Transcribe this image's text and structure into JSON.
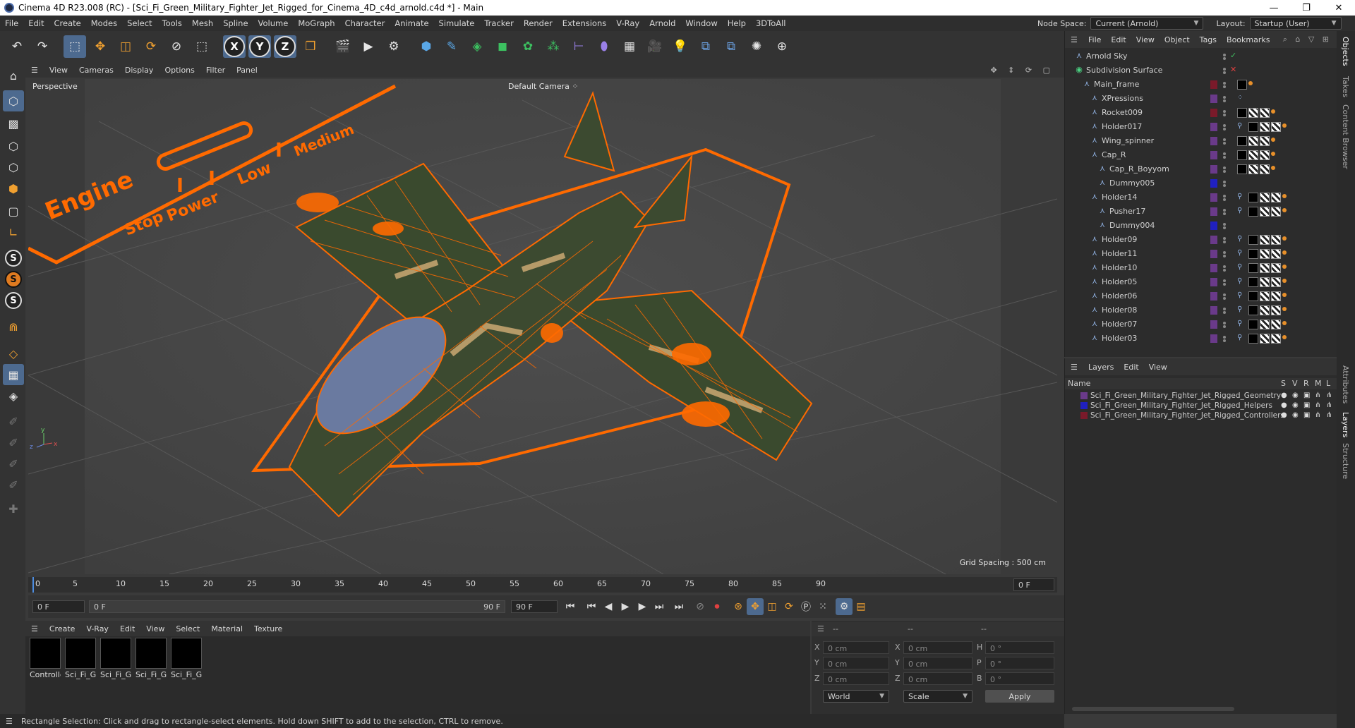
{
  "window": {
    "title": "Cinema 4D R23.008 (RC) - [Sci_Fi_Green_Military_Fighter_Jet_Rigged_for_Cinema_4D_c4d_arnold.c4d *] - Main",
    "controls": [
      "—",
      "❐",
      "✕"
    ]
  },
  "menu": [
    "File",
    "Edit",
    "Create",
    "Modes",
    "Select",
    "Tools",
    "Mesh",
    "Spline",
    "Volume",
    "MoGraph",
    "Character",
    "Animate",
    "Simulate",
    "Tracker",
    "Render",
    "Extensions",
    "V-Ray",
    "Arnold",
    "Window",
    "Help",
    "3DToAll"
  ],
  "node_space": {
    "label": "Node Space:",
    "value": "Current (Arnold)"
  },
  "layout": {
    "label": "Layout:",
    "value": "Startup (User)"
  },
  "toolbar": {
    "undo": "↶",
    "redo": "↷",
    "axis_x": "X",
    "axis_y": "Y",
    "axis_z": "Z"
  },
  "viewport": {
    "menu": [
      "View",
      "Cameras",
      "Display",
      "Options",
      "Filter",
      "Panel"
    ],
    "label": "Perspective",
    "camera": "Default Camera",
    "grid_spacing": "Grid Spacing : 500 cm",
    "hud_engine": "Engine",
    "hud_stop": "Stop",
    "hud_power": "Power",
    "hud_low": "Low",
    "hud_medium": "Medium"
  },
  "timeline": {
    "ticks": [
      "0",
      "5",
      "10",
      "15",
      "20",
      "25",
      "30",
      "35",
      "40",
      "45",
      "50",
      "55",
      "60",
      "65",
      "70",
      "75",
      "80",
      "85",
      "90"
    ],
    "current_frame": "0 F",
    "start_frame": "0 F",
    "range_start": "0 F",
    "range_end": "90 F",
    "end_frame": "90 F"
  },
  "material_manager": {
    "menu": [
      "Create",
      "V-Ray",
      "Edit",
      "View",
      "Select",
      "Material",
      "Texture"
    ],
    "materials": [
      "Controlle",
      "Sci_Fi_Gr",
      "Sci_Fi_Gr",
      "Sci_Fi_Gr",
      "Sci_Fi_Gr"
    ]
  },
  "coordinates": {
    "header1": "--",
    "header2": "--",
    "header3": "--",
    "rows": [
      {
        "a": "X",
        "av": "0 cm",
        "b": "X",
        "bv": "0 cm",
        "c": "H",
        "cv": "0 °"
      },
      {
        "a": "Y",
        "av": "0 cm",
        "b": "Y",
        "bv": "0 cm",
        "c": "P",
        "cv": "0 °"
      },
      {
        "a": "Z",
        "av": "0 cm",
        "b": "Z",
        "bv": "0 cm",
        "c": "B",
        "cv": "0 °"
      }
    ],
    "mode1": "World",
    "mode2": "Scale",
    "apply": "Apply"
  },
  "status": "Rectangle Selection: Click and drag to rectangle-select elements. Hold down SHIFT to add to the selection, CTRL to remove.",
  "object_manager": {
    "menu": [
      "File",
      "Edit",
      "View",
      "Object",
      "Tags",
      "Bookmarks"
    ],
    "objects": [
      {
        "name": "Arnold Sky",
        "indent": 0
      },
      {
        "name": "Subdivision Surface",
        "indent": 0
      },
      {
        "name": "Main_frame",
        "indent": 1
      },
      {
        "name": "XPressions",
        "indent": 2
      },
      {
        "name": "Rocket009",
        "indent": 2
      },
      {
        "name": "Holder017",
        "indent": 2
      },
      {
        "name": "Wing_spinner",
        "indent": 2
      },
      {
        "name": "Cap_R",
        "indent": 2
      },
      {
        "name": "Cap_R_Boyyom",
        "indent": 3
      },
      {
        "name": "Dummy005",
        "indent": 3
      },
      {
        "name": "Holder14",
        "indent": 2
      },
      {
        "name": "Pusher17",
        "indent": 3
      },
      {
        "name": "Dummy004",
        "indent": 3
      },
      {
        "name": "Holder09",
        "indent": 2
      },
      {
        "name": "Holder11",
        "indent": 2
      },
      {
        "name": "Holder10",
        "indent": 2
      },
      {
        "name": "Holder05",
        "indent": 2
      },
      {
        "name": "Holder06",
        "indent": 2
      },
      {
        "name": "Holder08",
        "indent": 2
      },
      {
        "name": "Holder07",
        "indent": 2
      },
      {
        "name": "Holder03",
        "indent": 2
      }
    ]
  },
  "layer_manager": {
    "menu": [
      "Layers",
      "Edit",
      "View"
    ],
    "columns": {
      "name": "Name",
      "s": "S",
      "v": "V",
      "r": "R",
      "m": "M",
      "l": "L"
    },
    "layers": [
      {
        "name": "Sci_Fi_Green_Military_Fighter_Jet_Rigged_Geometry",
        "color": "#6a3a8a"
      },
      {
        "name": "Sci_Fi_Green_Military_Fighter_Jet_Rigged_Helpers",
        "color": "#2020c0"
      },
      {
        "name": "Sci_Fi_Green_Military_Fighter_Jet_Rigged_Controllers",
        "color": "#7a1a2a"
      }
    ]
  },
  "side_tabs": [
    "Objects",
    "Takes",
    "Content Browser",
    "Attributes",
    "Layers",
    "Structure"
  ],
  "colors": {
    "wire": "#ff6a00",
    "accent": "#4d6a8f",
    "jet_body": "#3c4a30",
    "jet_stripe": "#b59a68"
  }
}
